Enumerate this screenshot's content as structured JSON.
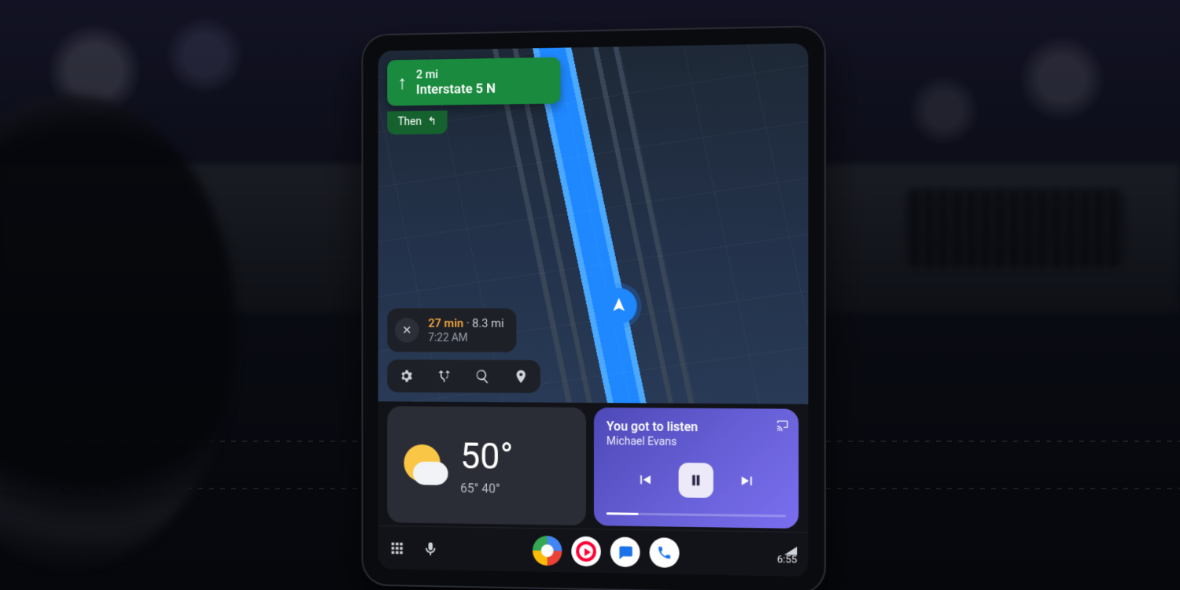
{
  "nav": {
    "distance": "2 mi",
    "road": "Interstate 5 N",
    "then_label": "Then"
  },
  "eta": {
    "duration": "27 min",
    "separator": " · ",
    "distance": "8.3 mi",
    "arrival": "7:22 AM"
  },
  "weather": {
    "temp": "50°",
    "high": "65°",
    "low": "40°"
  },
  "media": {
    "track": "You got to listen",
    "artist": "Michael Evans"
  },
  "status": {
    "time": "6:55"
  }
}
